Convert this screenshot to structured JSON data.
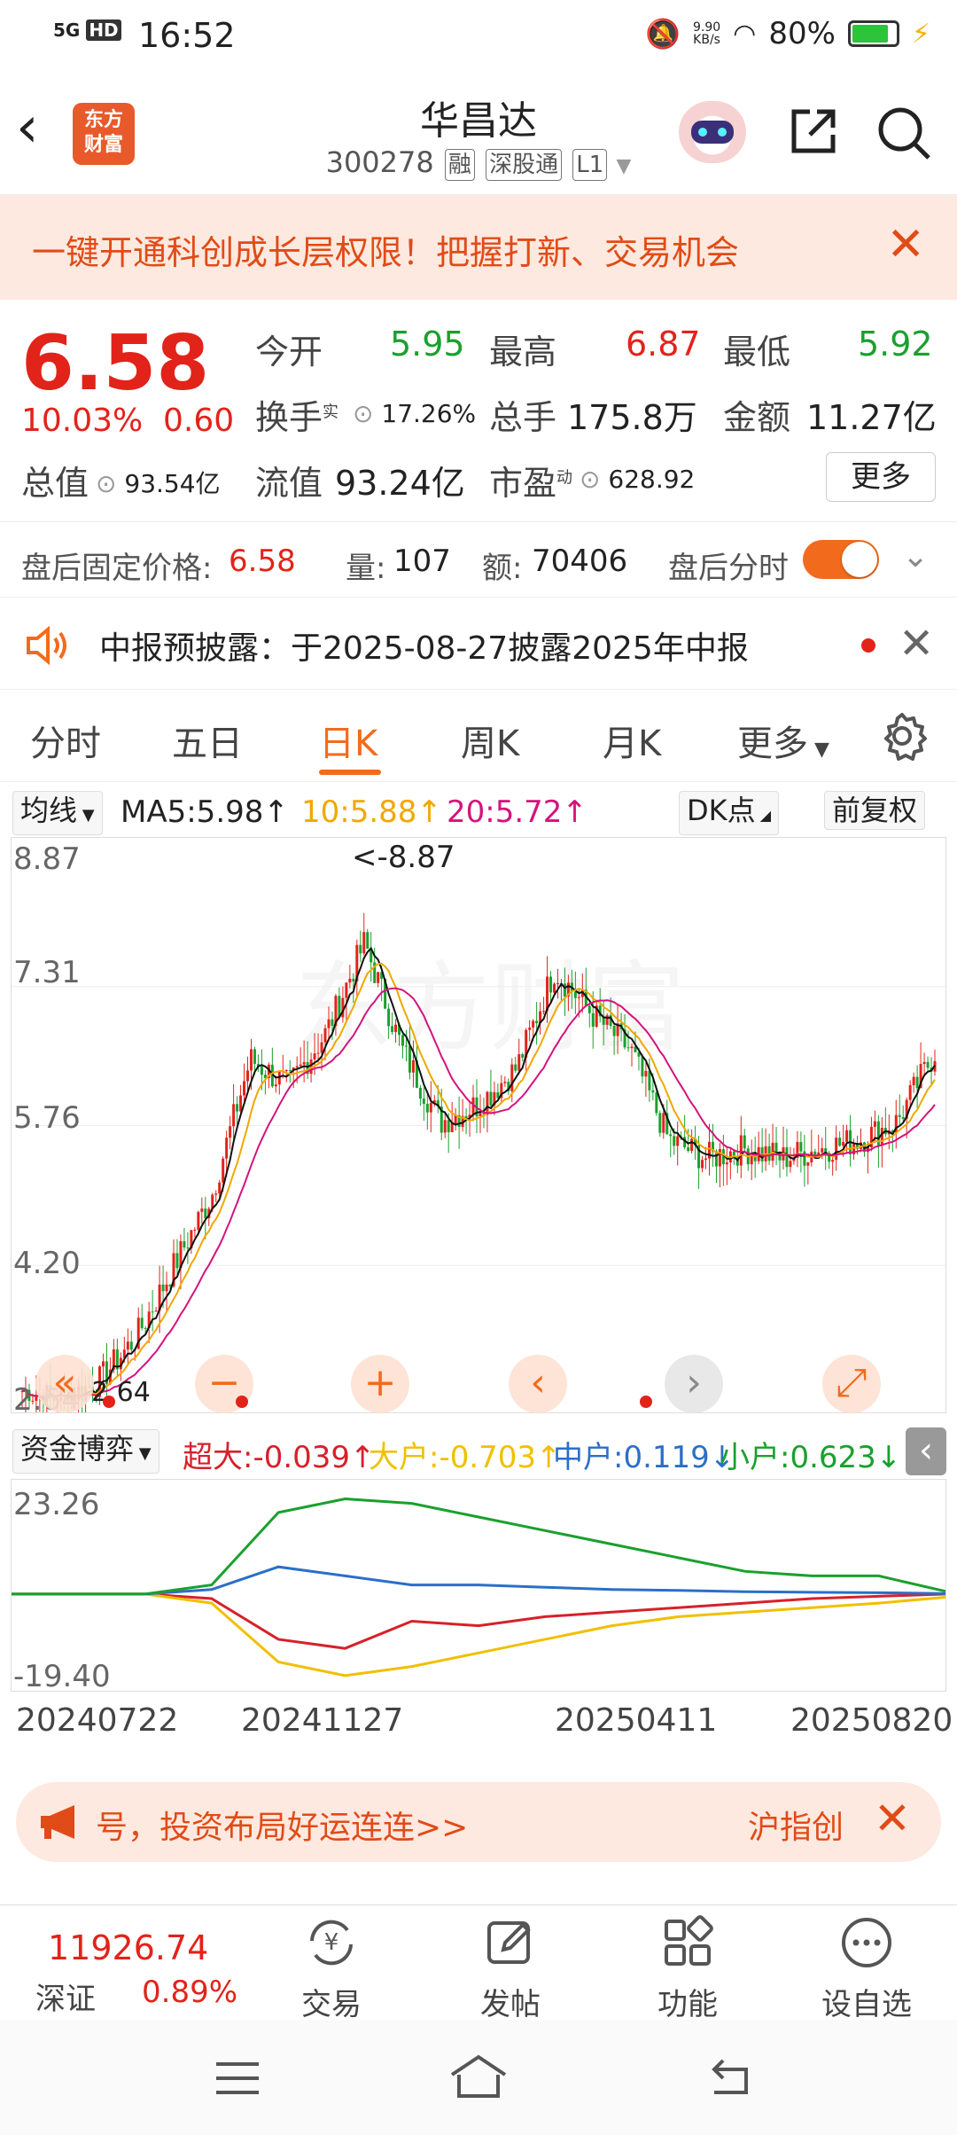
{
  "status_bar": {
    "time": "16:52",
    "network": "5G",
    "hd": "HD",
    "speed": "9.90\nKB/s",
    "battery": "80%"
  },
  "header": {
    "title": "华昌达",
    "code": "300278",
    "tags": [
      "融",
      "深股通",
      "L1"
    ],
    "logo_text": "东方\n财富"
  },
  "banner": {
    "text": "一键开通科创成长层权限！把握打新、交易机会"
  },
  "quote": {
    "price": "6.58",
    "change_pct": "10.03%",
    "change": "0.60",
    "open_label": "今开",
    "open": "5.95",
    "high_label": "最高",
    "high": "6.87",
    "low_label": "最低",
    "low": "5.92",
    "turnover_label": "换手",
    "turnover_sup": "实",
    "turnover": "17.26%",
    "volume_label": "总手",
    "volume": "175.8万",
    "amount_label": "金额",
    "amount": "11.27亿",
    "mktcap_label": "总值",
    "mktcap": "93.54亿",
    "float_label": "流值",
    "float": "93.24亿",
    "pe_label": "市盈",
    "pe_sup": "动",
    "pe": "628.92",
    "more": "更多"
  },
  "after_hours": {
    "label": "盘后固定价格:",
    "price": "6.58",
    "qty_label": "量:",
    "qty": "107",
    "amt_label": "额:",
    "amt": "70406",
    "toggle_label": "盘后分时"
  },
  "notice": {
    "text": "中报预披露：于2025-08-27披露2025年中报"
  },
  "tabs": [
    "分时",
    "五日",
    "日K",
    "周K",
    "月K",
    "更多"
  ],
  "ma": {
    "dropdown": "均线",
    "ma5": "MA5:5.98↑",
    "ma10": "10:5.88↑",
    "ma20": "20:5.72↑",
    "dk": "DK点",
    "fq": "前复权"
  },
  "chart_data": [
    {
      "type": "candlestick",
      "y_ticks": [
        "8.87",
        "7.31",
        "5.76",
        "4.20",
        "2.64"
      ],
      "ylim": [
        2.64,
        8.87
      ],
      "high_marker": "<-8.87",
      "low_marker": "2.64",
      "x_dates": [
        "20240722",
        "20241127",
        "20250411",
        "20250820"
      ],
      "close_approx": [
        2.8,
        2.7,
        2.9,
        3.4,
        4.2,
        5.0,
        6.5,
        6.2,
        6.8,
        7.8,
        6.6,
        5.8,
        6.0,
        6.4,
        7.5,
        7.0,
        6.6,
        5.6,
        5.4,
        5.5,
        5.4,
        5.5,
        5.6,
        5.8,
        6.58
      ],
      "ma_colors": {
        "ma5": "#111111",
        "ma10": "#f0a800",
        "ma20": "#d4137d"
      }
    },
    {
      "type": "line",
      "title": "资金博弈",
      "y_ticks": [
        "23.26",
        "-19.40"
      ],
      "ylim": [
        -19.4,
        23.26
      ],
      "series": [
        {
          "name": "超大",
          "label": "超大:-0.039↑",
          "color": "#d6212a",
          "values": [
            0,
            0,
            0,
            -1,
            -10,
            -12,
            -6,
            -7,
            -5,
            -4,
            -3,
            -2,
            -1,
            -0.5,
            0
          ]
        },
        {
          "name": "大户",
          "label": "大户:-0.703↑",
          "color": "#f0c000",
          "values": [
            0,
            0,
            0,
            -2,
            -15,
            -18,
            -16,
            -13,
            -10,
            -7,
            -5,
            -4,
            -3,
            -2,
            -0.7
          ]
        },
        {
          "name": "中户",
          "label": "中户:0.119↓",
          "color": "#2b6fc8",
          "values": [
            0,
            0,
            0,
            1,
            6,
            4,
            2,
            2,
            1.5,
            1,
            0.8,
            0.5,
            0.4,
            0.3,
            0.1
          ]
        },
        {
          "name": "小户",
          "label": "小户:0.623↓",
          "color": "#1aa02d",
          "values": [
            0,
            0,
            0,
            2,
            18,
            21,
            20,
            17,
            14,
            11,
            8,
            5,
            4,
            4,
            0.6
          ]
        }
      ]
    }
  ],
  "bottom_banner": {
    "text": "号，投资布局好运连连>>",
    "right": "沪指创"
  },
  "bottom_nav": {
    "index_value": "11926.74",
    "index_name": "深证",
    "index_pct": "0.89%",
    "items": [
      "交易",
      "发帖",
      "功能",
      "设自选"
    ]
  }
}
